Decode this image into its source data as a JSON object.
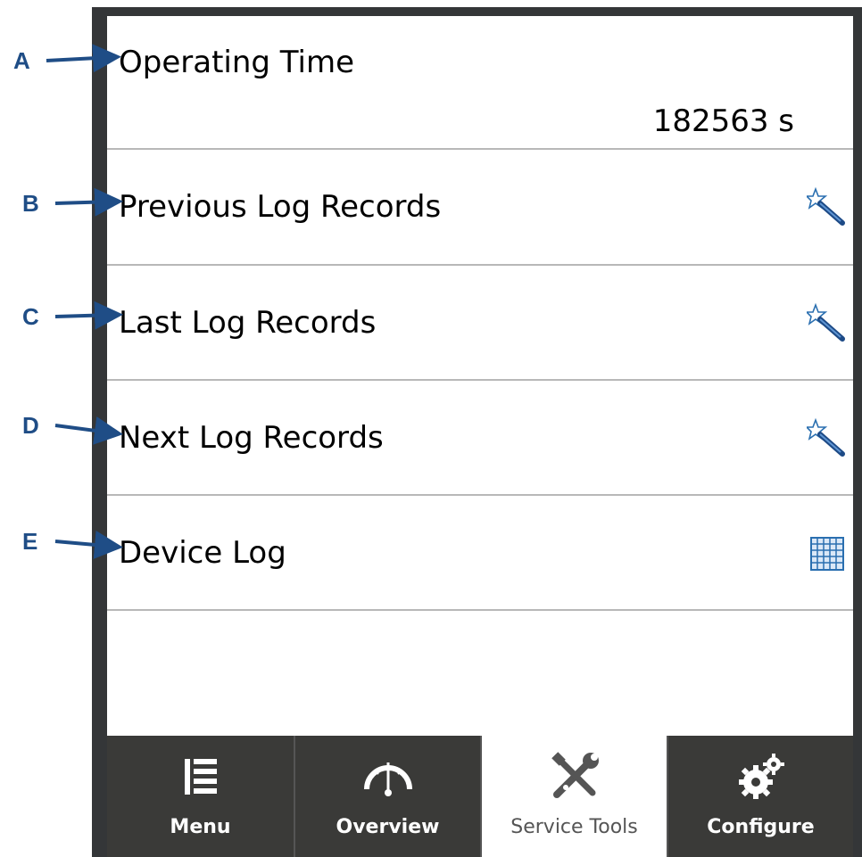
{
  "annotations": [
    "A",
    "B",
    "C",
    "D",
    "E"
  ],
  "rows": [
    {
      "label": "Operating Time",
      "value": "182563 s",
      "icon": null
    },
    {
      "label": "Previous Log Records",
      "icon": "wand-icon"
    },
    {
      "label": "Last Log Records",
      "icon": "wand-icon"
    },
    {
      "label": "Next Log Records",
      "icon": "wand-icon"
    },
    {
      "label": "Device Log",
      "icon": "grid-icon"
    }
  ],
  "nav": [
    {
      "label": "Menu",
      "icon": "list-icon",
      "active": false
    },
    {
      "label": "Overview",
      "icon": "gauge-icon",
      "active": false
    },
    {
      "label": "Service Tools",
      "icon": "tools-icon",
      "active": true
    },
    {
      "label": "Configure",
      "icon": "gears-icon",
      "active": false
    }
  ],
  "colors": {
    "annotation": "#1f4d86",
    "frame": "#343638",
    "navbar": "#3a3a38",
    "divider": "#b8b8b8"
  }
}
